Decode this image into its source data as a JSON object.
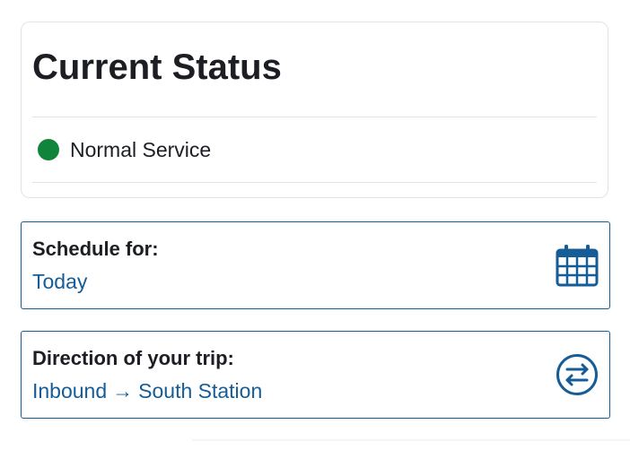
{
  "status": {
    "title": "Current Status",
    "text": "Normal Service",
    "color": "#11843c"
  },
  "schedule": {
    "label": "Schedule for:",
    "value": "Today",
    "icon": "calendar-icon"
  },
  "direction": {
    "label": "Direction of your trip:",
    "from": "Inbound",
    "arrow": "→",
    "to": "South Station",
    "icon": "swap-direction-icon"
  },
  "colors": {
    "accent": "#165c96",
    "status_green": "#11843c",
    "text": "#1c1e23",
    "border": "#e2e3e5"
  }
}
